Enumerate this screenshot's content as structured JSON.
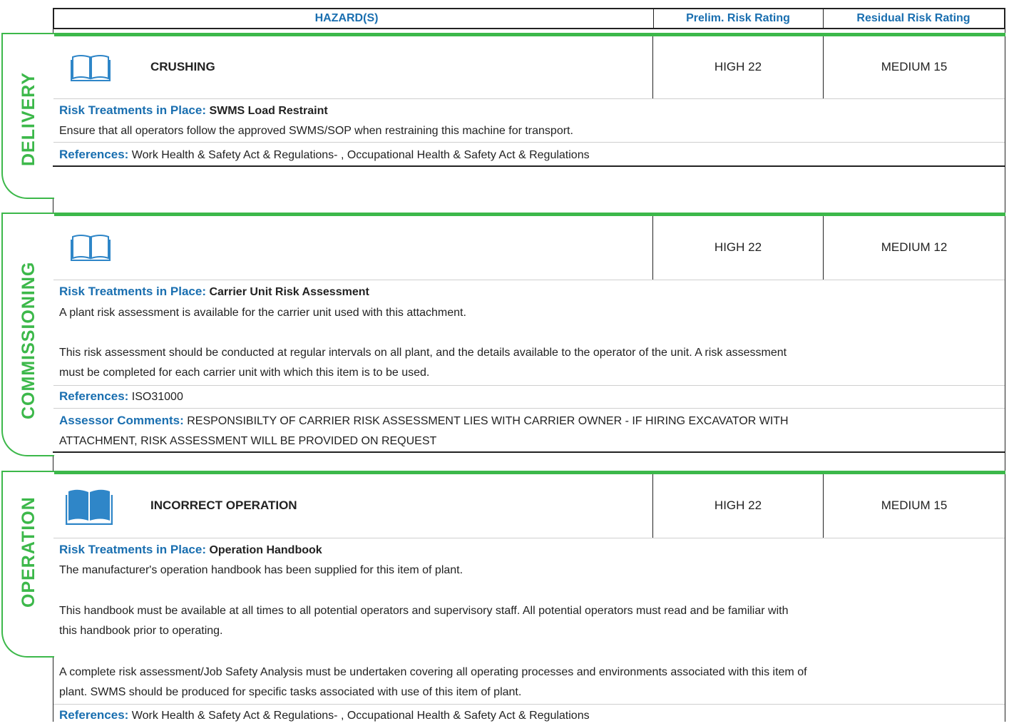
{
  "header": {
    "hazards": "HAZARD(S)",
    "prelim": "Prelim. Risk Rating",
    "residual": "Residual Risk Rating"
  },
  "sections": [
    {
      "tab": "DELIVERY",
      "hazard": "CRUSHING",
      "prelim": "HIGH 22",
      "residual": "MEDIUM 15",
      "treat_label": "Risk Treatments in Place:",
      "treat_name": "SWMS Load Restraint",
      "treat_text": [
        "Ensure that all operators follow the approved SWMS/SOP when restraining this machine for transport."
      ],
      "ref_label": "References:",
      "ref_text": "Work Health & Safety Act & Regulations- , Occupational Health & Safety Act & Regulations"
    },
    {
      "tab": "COMMISSIONING",
      "hazard": "",
      "prelim": "HIGH 22",
      "residual": "MEDIUM 12",
      "treat_label": "Risk Treatments in Place:",
      "treat_name": "Carrier Unit Risk Assessment",
      "treat_text": [
        "A plant risk assessment is available for the carrier unit used with this attachment.",
        "This risk assessment should be conducted at regular intervals on all plant, and the details available to the operator of the unit. A risk assessment",
        "must be completed for each carrier unit with which this item is to be used."
      ],
      "ref_label": "References:",
      "ref_text": "ISO31000",
      "comment_label": "Assessor Comments:",
      "comment_text": [
        "RESPONSIBILTY OF CARRIER RISK ASSESSMENT LIES WITH CARRIER OWNER - IF HIRING EXCAVATOR WITH",
        "ATTACHMENT, RISK ASSESSMENT WILL BE PROVIDED ON REQUEST"
      ]
    },
    {
      "tab": "OPERATION",
      "hazard": "INCORRECT OPERATION",
      "prelim": "HIGH 22",
      "residual": "MEDIUM 15",
      "treat_label": "Risk Treatments in Place:",
      "treat_name": "Operation Handbook",
      "treat_text": [
        "The manufacturer's operation handbook has been supplied for this item of plant.",
        "This handbook must be available at all times to all potential operators and supervisory staff. All potential operators must read and be familiar with",
        "this handbook prior to operating.",
        "A complete risk assessment/Job Safety Analysis must be undertaken covering all operating processes and environments associated with this item of",
        "plant. SWMS should be produced for specific tasks associated with use of this item of plant."
      ],
      "ref_label": "References:",
      "ref_text": "Work Health & Safety Act & Regulations- , Occupational Health & Safety Act & Regulations"
    }
  ],
  "colors": {
    "accent_blue": "#1a6fb0",
    "section_green": "#3cb84a"
  },
  "icons": [
    "book-outline-icon",
    "book-outline-icon",
    "book-filled-icon"
  ]
}
